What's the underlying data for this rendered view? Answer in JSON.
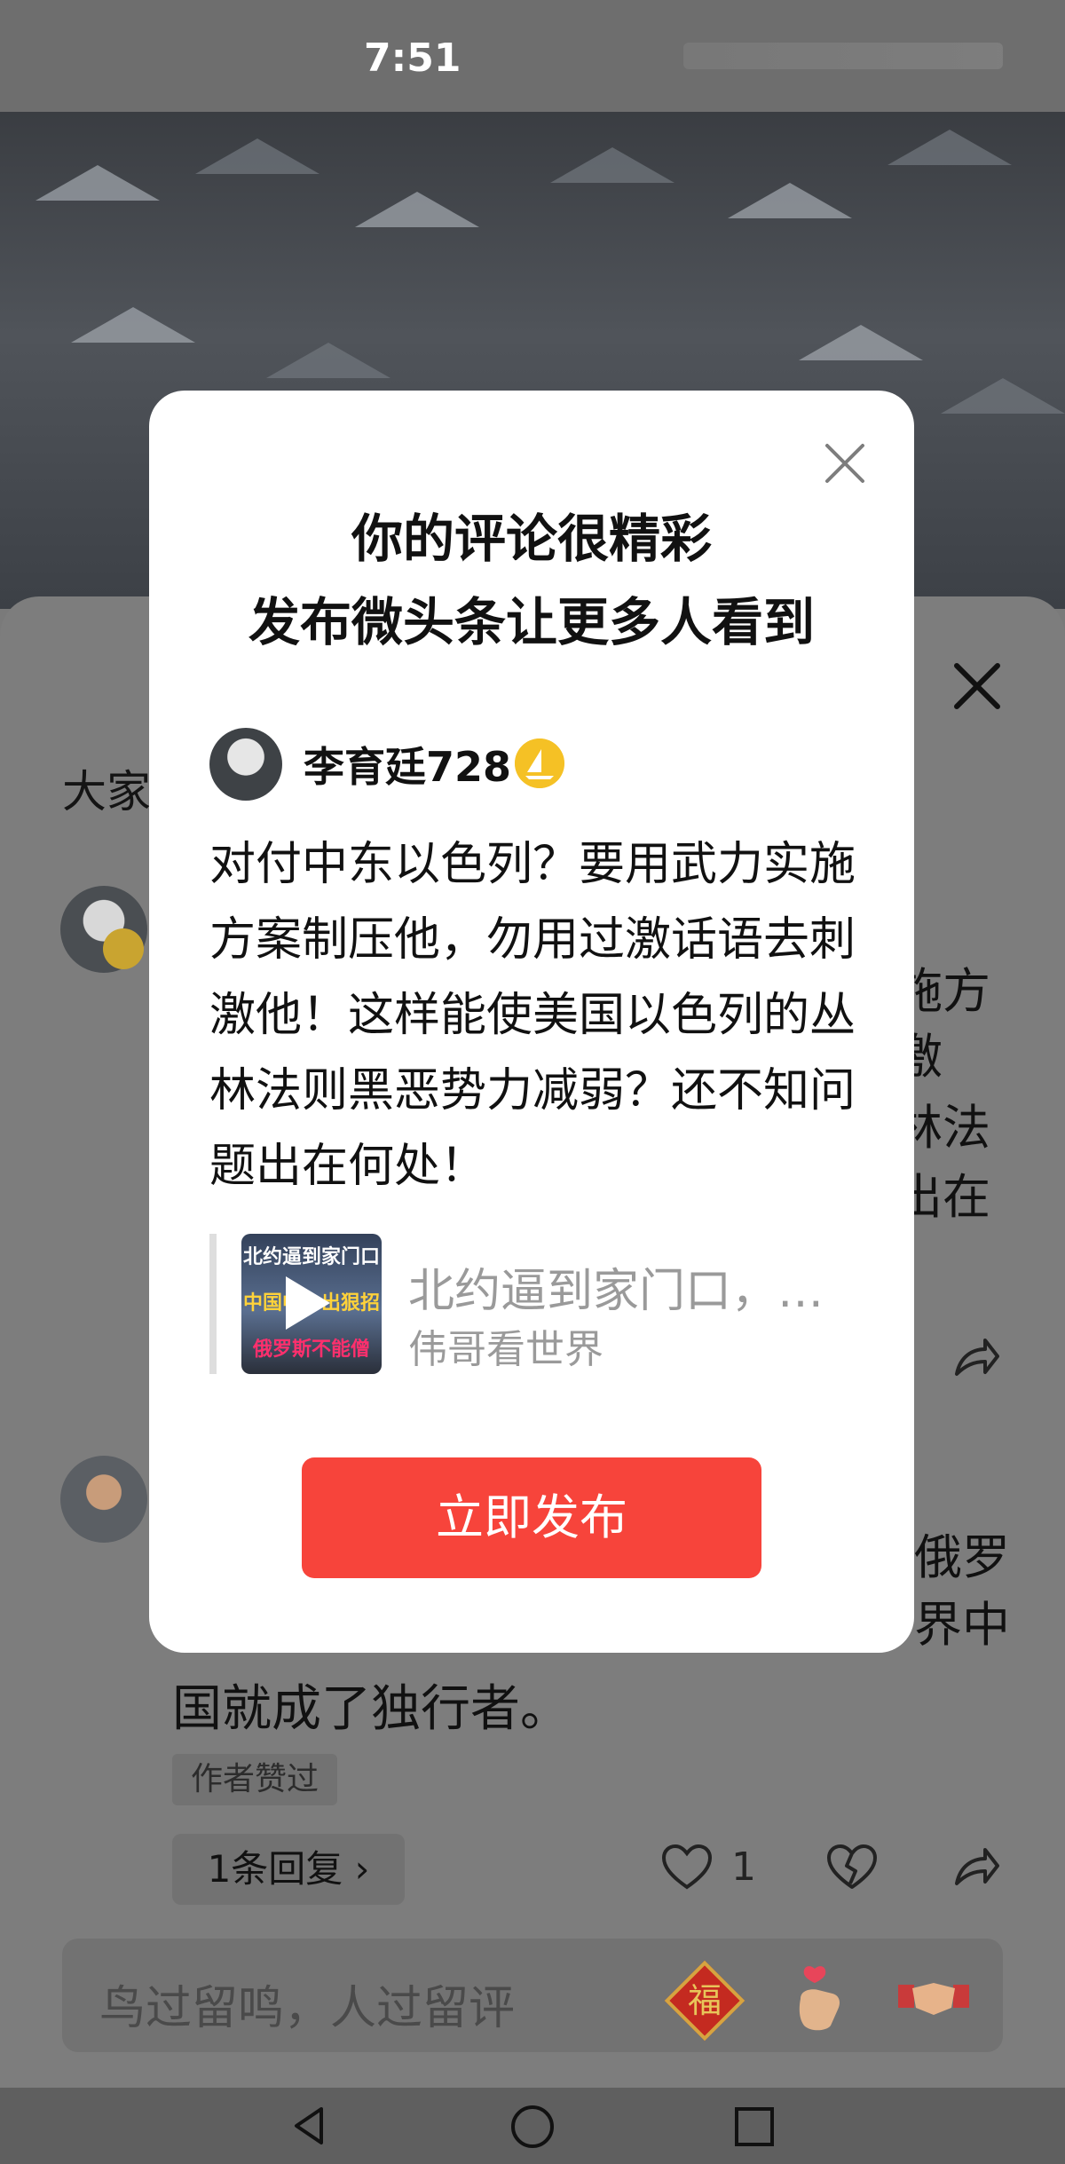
{
  "status_bar": {
    "time": "7:51"
  },
  "comment_sheet": {
    "heading": "大家",
    "comment1": {
      "text_fragments": [
        "施方",
        "激",
        "林法",
        "出在"
      ]
    },
    "comment2": {
      "text_fragments": [
        "俄罗",
        "界中"
      ],
      "text_last_line": "国就成了独行者。",
      "author_liked_label": "作者赞过",
      "replies_label": "1条回复 ›",
      "like_count": "1"
    },
    "input_placeholder": "鸟过留鸣，人过留评",
    "sticker_fu": "福"
  },
  "modal": {
    "title_line1": "你的评论很精彩",
    "title_line2": "发布微头条让更多人看到",
    "username": "李育廷728",
    "post_text": "对付中东以色列？要用武力实施方案制压他，勿用过激话语去刺激他！这样能使美国以色列的丛林法则黑恶势力减弱？还不知问题出在何处！",
    "link": {
      "title": "北约逼到家门口，…",
      "source": "伟哥看世界",
      "thumbnail_text": [
        "北约逼到家门口",
        "中国中…出狠招",
        "俄罗斯不能僧"
      ]
    },
    "publish_button": "立即发布"
  },
  "colors": {
    "accent": "#f7443b",
    "overlay": "#7d7d7d"
  }
}
